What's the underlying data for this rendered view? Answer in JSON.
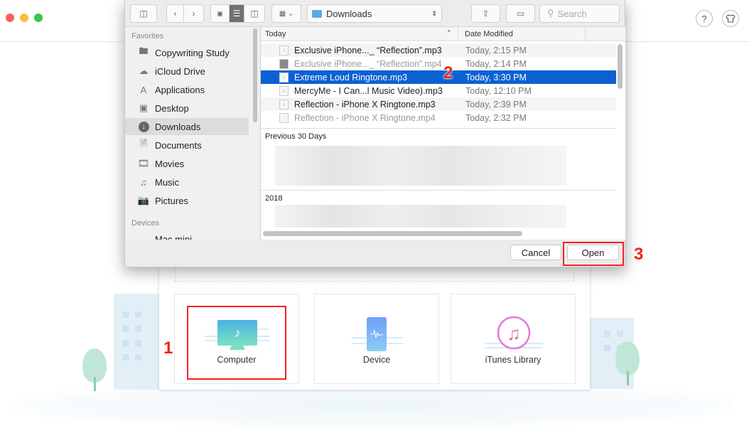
{
  "window": {
    "help_icon": "question-icon",
    "skin_icon": "tshirt-icon",
    "help_label": "?"
  },
  "dialog": {
    "location": "Downloads",
    "search_placeholder": "Search",
    "sidebar": {
      "favorites_header": "Favorites",
      "favorites": [
        {
          "label": "Copywriting Study",
          "icon": "folder-icon"
        },
        {
          "label": "iCloud Drive",
          "icon": "cloud-icon"
        },
        {
          "label": "Applications",
          "icon": "applications-icon"
        },
        {
          "label": "Desktop",
          "icon": "desktop-icon"
        },
        {
          "label": "Downloads",
          "icon": "download-icon",
          "selected": true
        },
        {
          "label": "Documents",
          "icon": "documents-icon"
        },
        {
          "label": "Movies",
          "icon": "film-icon"
        },
        {
          "label": "Music",
          "icon": "music-note-icon"
        },
        {
          "label": "Pictures",
          "icon": "camera-icon"
        }
      ],
      "devices_header": "Devices",
      "devices": [
        {
          "label": "Mac mini",
          "icon": "mac-mini-icon"
        }
      ]
    },
    "columns": {
      "name": "Today",
      "date": "Date Modified"
    },
    "files": [
      {
        "name": "Exclusive iPhone..._ “Reflection”.mp3",
        "date": "Today, 2:15 PM",
        "dim": false
      },
      {
        "name": "Exclusive iPhone..._ “Reflection”.mp4",
        "date": "Today, 2:14 PM",
        "dim": true
      },
      {
        "name": "Extreme Loud Ringtone.mp3",
        "date": "Today, 3:30 PM",
        "selected": true
      },
      {
        "name": "MercyMe - I Can...l Music Video).mp3",
        "date": "Today, 12:10 PM",
        "dim": false
      },
      {
        "name": "Reflection - iPhone X Ringtone.mp3",
        "date": "Today, 2:39 PM",
        "dim": false
      },
      {
        "name": "Reflection - iPhone X Ringtone.mp4",
        "date": "Today, 2:32 PM",
        "dim": true
      }
    ],
    "groups": [
      "Previous 30 Days",
      "2018"
    ],
    "cancel_label": "Cancel",
    "open_label": "Open"
  },
  "sources": [
    {
      "label": "Computer",
      "icon": "computer-music-icon"
    },
    {
      "label": "Device",
      "icon": "phone-icon"
    },
    {
      "label": "iTunes Library",
      "icon": "itunes-icon"
    }
  ],
  "steps": [
    "1",
    "2",
    "3"
  ],
  "colors": {
    "selection": "#0c61d2",
    "annotation": "#f0241b"
  }
}
